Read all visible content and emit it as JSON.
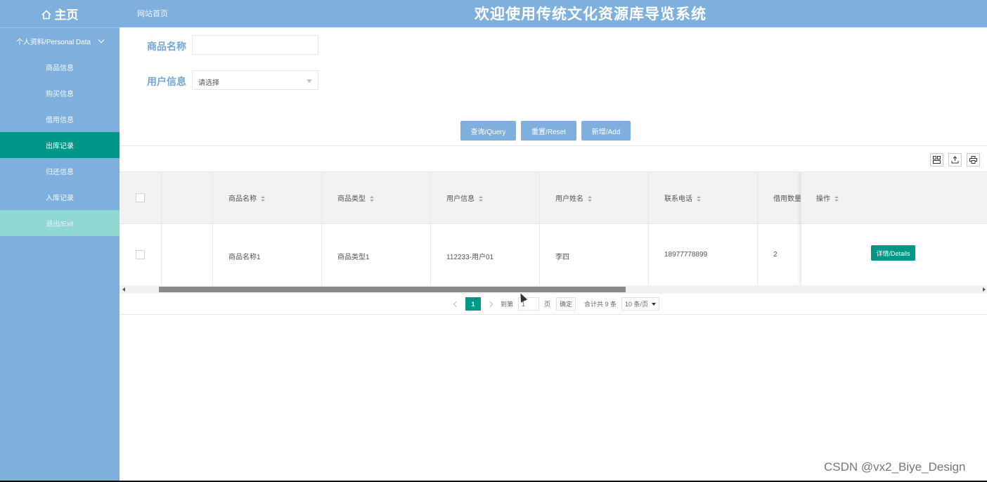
{
  "header": {
    "home_label": "主页",
    "breadcrumb": "网站首页",
    "title": "欢迎使用传统文化资源库导览系统"
  },
  "sidebar": {
    "group_label": "个人资料/Personal Data",
    "items": [
      {
        "label": "商品信息"
      },
      {
        "label": "购买信息"
      },
      {
        "label": "借用信息"
      },
      {
        "label": "出库记录"
      },
      {
        "label": "归还信息"
      },
      {
        "label": "入库记录"
      },
      {
        "label": "退出/Exit"
      }
    ],
    "active_index": 3
  },
  "search": {
    "name_label": "商品名称",
    "name_value": "",
    "user_label": "用户信息",
    "user_placeholder": "请选择"
  },
  "buttons": {
    "query": "查询/Query",
    "reset": "重置/Reset",
    "add": "新增/Add"
  },
  "toolbar": {
    "icons": [
      "columns-icon",
      "export-icon",
      "print-icon"
    ]
  },
  "table": {
    "columns": [
      "商品名称",
      "商品类型",
      "用户信息",
      "用户姓名",
      "联系电话",
      "借用数量",
      "操作"
    ],
    "rows": [
      {
        "name": "商品名称1",
        "type": "商品类型1",
        "user_info": "112233-用户01",
        "user_name": "李四",
        "phone": "18977778899",
        "quantity": "2",
        "action": "详情/Details"
      }
    ]
  },
  "pagination": {
    "current_page": "1",
    "goto_label": "到第",
    "goto_value": "1",
    "page_unit": "页",
    "confirm": "确定",
    "total": "合计共 9 条",
    "per_page": "10 条/页"
  },
  "watermark": "CSDN @vx2_Biye_Design",
  "colors": {
    "primary": "#7fb0dd",
    "accent": "#009688",
    "exit": "#8fd8d2"
  }
}
